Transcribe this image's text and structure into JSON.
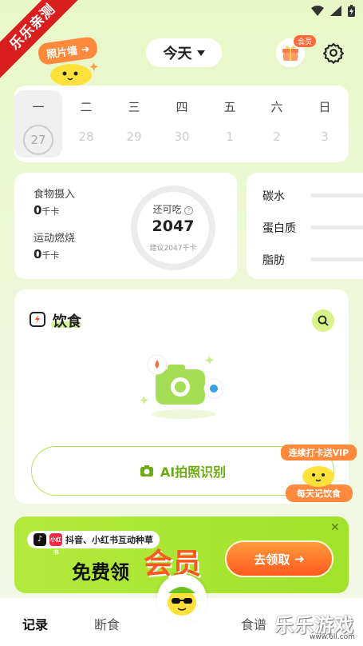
{
  "watermark": {
    "ribbon": "乐乐亲测",
    "corner": "乐乐游戏",
    "url": "www.6ll.com"
  },
  "header": {
    "photo_wall": "照片墙",
    "date_selector": "今天",
    "vip_badge": "会员"
  },
  "week": [
    {
      "name": "一",
      "num": "27",
      "active": true
    },
    {
      "name": "二",
      "num": "28"
    },
    {
      "name": "三",
      "num": "29"
    },
    {
      "name": "四",
      "num": "30"
    },
    {
      "name": "五",
      "num": "1"
    },
    {
      "name": "六",
      "num": "2"
    },
    {
      "name": "日",
      "num": "3"
    }
  ],
  "intake": {
    "food_label": "食物摄入",
    "food_value": "0",
    "food_unit": "千卡",
    "burn_label": "运动燃烧",
    "burn_value": "0",
    "burn_unit": "千卡",
    "remaining_label": "还可吃",
    "remaining_value": "2047",
    "suggest_text": "建议2047千卡"
  },
  "macros": [
    "碳水",
    "蛋白质",
    "脂肪"
  ],
  "diet": {
    "title": "饮食",
    "ai_button": "AI拍照识别"
  },
  "streak": {
    "top": "连续打卡送VIP",
    "bottom": "每天记饮食"
  },
  "promo": {
    "tag": "抖音、小红书互动种草",
    "tiktok": "♪",
    "xhs": "小红书",
    "free": "免费领",
    "vip": "会员",
    "cta": "去领取",
    "close": "✕"
  },
  "nav": {
    "record": "记录",
    "fasting": "断食",
    "recipes": "食谱"
  },
  "colors": {
    "accent": "#a0e22c",
    "orange": "#ff8a3d",
    "bg": "#e9f7c8"
  }
}
